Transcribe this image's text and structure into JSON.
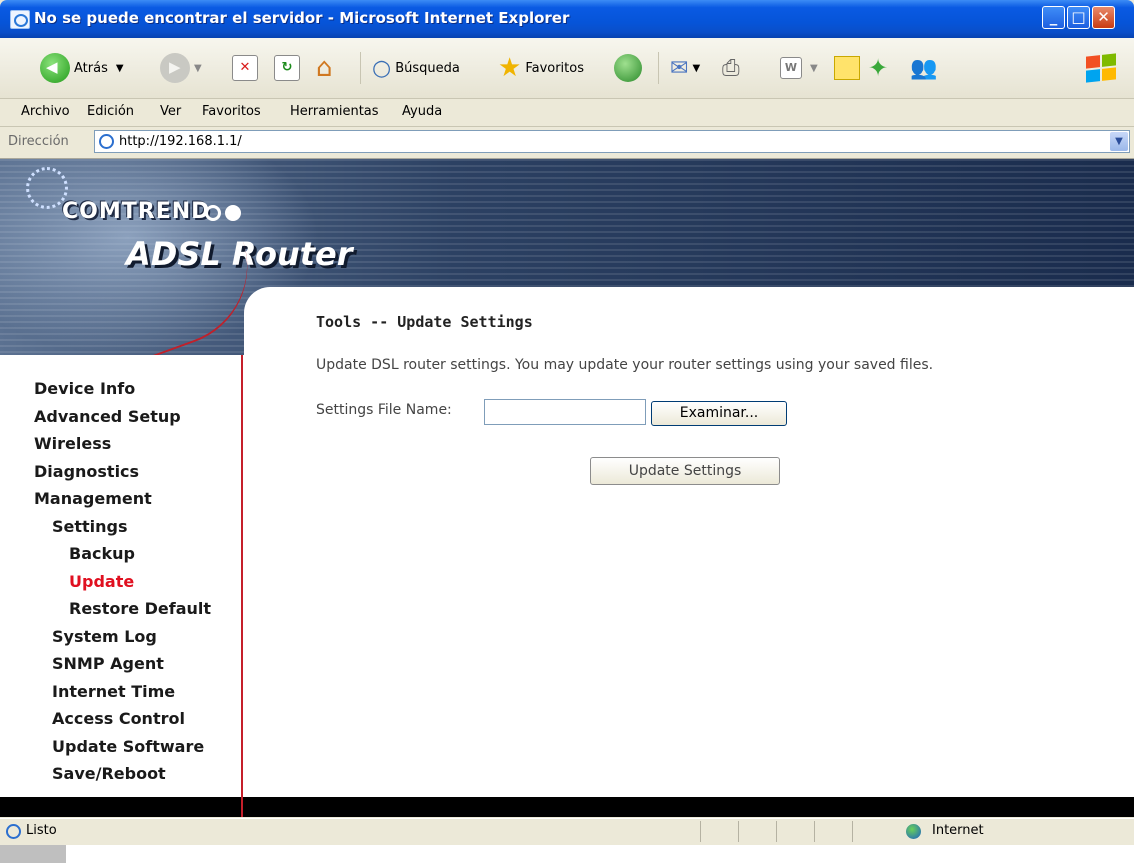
{
  "window": {
    "title": "No se puede encontrar el servidor - Microsoft Internet Explorer"
  },
  "toolbar": {
    "back_label": "Atrás",
    "search_label": "Búsqueda",
    "favorites_label": "Favoritos"
  },
  "menu": [
    "Archivo",
    "Edición",
    "Ver",
    "Favoritos",
    "Herramientas",
    "Ayuda"
  ],
  "address": {
    "label": "Dirección",
    "url": "http://192.168.1.1/"
  },
  "router": {
    "brand": "COMTREND",
    "product": "ADSL Router",
    "nav": [
      {
        "label": "Device Info",
        "level": 0
      },
      {
        "label": "Advanced Setup",
        "level": 0
      },
      {
        "label": "Wireless",
        "level": 0
      },
      {
        "label": "Diagnostics",
        "level": 0
      },
      {
        "label": "Management",
        "level": 0
      },
      {
        "label": "Settings",
        "level": 1
      },
      {
        "label": "Backup",
        "level": 2
      },
      {
        "label": "Update",
        "level": 2,
        "active": true
      },
      {
        "label": "Restore Default",
        "level": 2
      },
      {
        "label": "System Log",
        "level": 1
      },
      {
        "label": "SNMP Agent",
        "level": 1
      },
      {
        "label": "Internet Time",
        "level": 1
      },
      {
        "label": "Access Control",
        "level": 1
      },
      {
        "label": "Update Software",
        "level": 1
      },
      {
        "label": "Save/Reboot",
        "level": 1
      }
    ]
  },
  "page": {
    "heading": "Tools -- Update Settings",
    "description": "Update DSL router settings. You may update your router settings using your saved files.",
    "file_label": "Settings File Name:",
    "file_value": "",
    "browse_label": "Examinar...",
    "submit_label": "Update Settings"
  },
  "status": {
    "text": "Listo",
    "zone": "Internet"
  },
  "colors": {
    "titlebar": "#0654d8",
    "accent_red": "#c51f2a",
    "active_nav": "#e01020"
  }
}
